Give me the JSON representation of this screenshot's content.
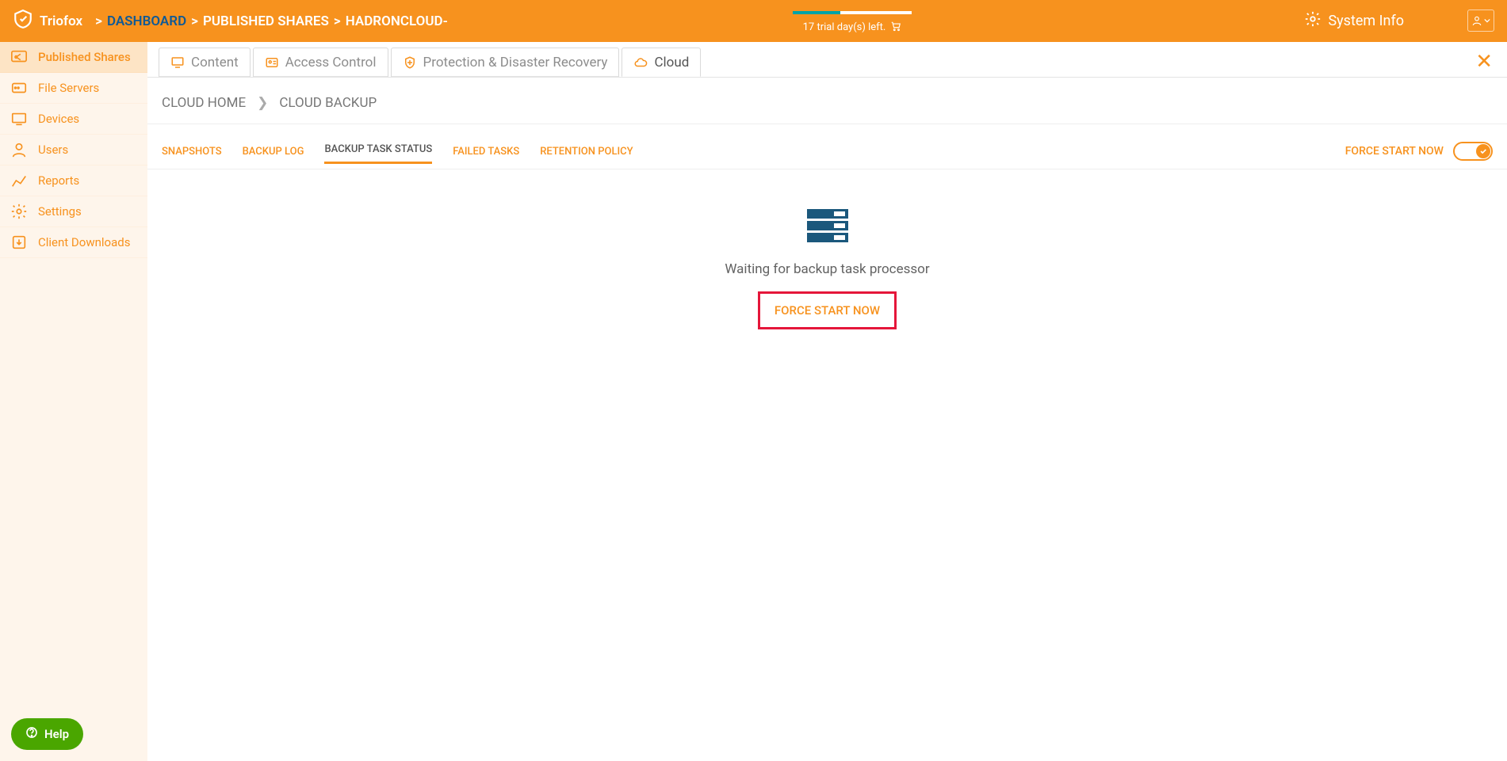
{
  "header": {
    "brand": "Triofox",
    "crumbs": [
      "DASHBOARD",
      "PUBLISHED SHARES",
      "HADRONCLOUD-"
    ],
    "trial_text": "17 trial day(s) left.",
    "system_info": "System Info"
  },
  "sidebar": {
    "items": [
      {
        "label": "Published Shares",
        "icon": "share"
      },
      {
        "label": "File Servers",
        "icon": "server"
      },
      {
        "label": "Devices",
        "icon": "device"
      },
      {
        "label": "Users",
        "icon": "user"
      },
      {
        "label": "Reports",
        "icon": "report"
      },
      {
        "label": "Settings",
        "icon": "gear"
      },
      {
        "label": "Client Downloads",
        "icon": "download"
      }
    ]
  },
  "tabs": {
    "items": [
      {
        "label": "Content"
      },
      {
        "label": "Access Control"
      },
      {
        "label": "Protection & Disaster Recovery"
      },
      {
        "label": "Cloud"
      }
    ]
  },
  "crumbs2": {
    "a": "CLOUD HOME",
    "b": "CLOUD BACKUP"
  },
  "subtabs": {
    "items": [
      "SNAPSHOTS",
      "BACKUP LOG",
      "BACKUP TASK STATUS",
      "FAILED TASKS",
      "RETENTION POLICY"
    ],
    "force_start": "FORCE START NOW"
  },
  "center": {
    "wait_text": "Waiting for backup task processor",
    "force_start": "FORCE START NOW"
  },
  "help": {
    "label": "Help"
  }
}
